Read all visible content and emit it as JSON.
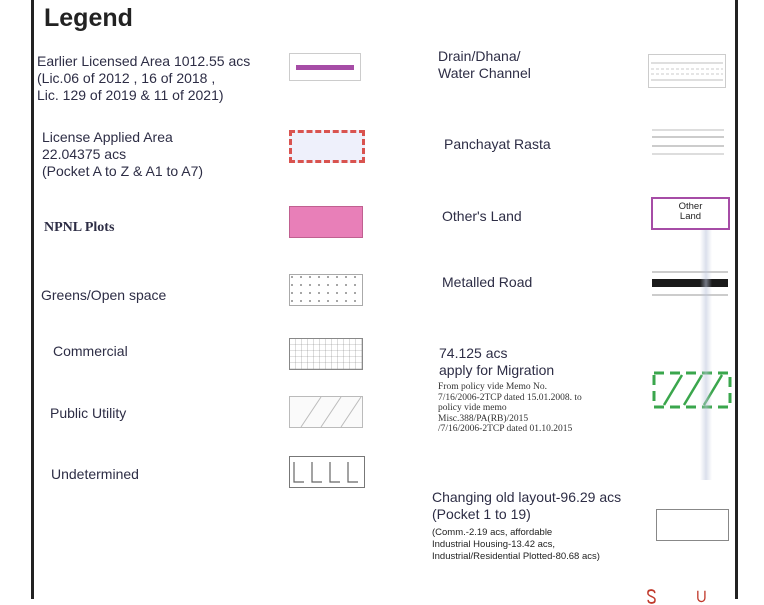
{
  "legend": {
    "title": "Legend",
    "left_items": [
      {
        "name": "earlier-licensed-area",
        "label": "Earlier Licensed Area 1012.55 acs\n(Lic.06 of 2012 , 16 of 2018 ,\nLic. 129 of 2019  & 11 of 2021)",
        "symbol": "purple-line",
        "color": "#a64ca6"
      },
      {
        "name": "license-applied-area",
        "label": "License Applied Area\n22.04375 acs\n(Pocket A to Z & A1 to A7)",
        "symbol": "red-dashed-box",
        "color": "#d9534f"
      },
      {
        "name": "npnl-plots",
        "label": "NPNL Plots",
        "symbol": "pink-fill",
        "color": "#e87fb8"
      },
      {
        "name": "greens-open-space",
        "label": "Greens/Open space",
        "symbol": "dotted-box"
      },
      {
        "name": "commercial",
        "label": "Commercial",
        "symbol": "grid-box"
      },
      {
        "name": "public-utility",
        "label": "Public Utility",
        "symbol": "hatched-box"
      },
      {
        "name": "undetermined",
        "label": "Undetermined",
        "symbol": "L-pattern-box"
      }
    ],
    "right_items": [
      {
        "name": "drain-water-channel",
        "label": "Drain/Dhana/\nWater Channel",
        "symbol": "channel-lines"
      },
      {
        "name": "panchayat-rasta",
        "label": "Panchayat Rasta",
        "symbol": "double-lines"
      },
      {
        "name": "others-land",
        "label": "Other's Land",
        "symbol": "other-land-box",
        "symbol_text": "Other\nLand",
        "color": "#a64ca6"
      },
      {
        "name": "metalled-road",
        "label": "Metalled Road",
        "symbol": "black-road-band"
      },
      {
        "name": "migration-area",
        "label": "74.125 acs\napply for Migration",
        "note": "From policy vide Memo No.\n7/16/2006-2TCP dated 15.01.2008. to\npolicy vide memo\nMisc.388/PA(RB)/2015\n/7/16/2006-2TCP dated 01.10.2015",
        "symbol": "green-hatched-box",
        "color": "#3aa64c"
      },
      {
        "name": "changing-old-layout",
        "label": "Changing old layout-96.29 acs\n(Pocket 1 to 19)",
        "note": "(Comm.-2.19 acs, affordable\nIndustrial Housing-13.42 acs,\nIndustrial/Residential Plotted-80.68 acs)",
        "symbol": "empty-box"
      }
    ]
  }
}
